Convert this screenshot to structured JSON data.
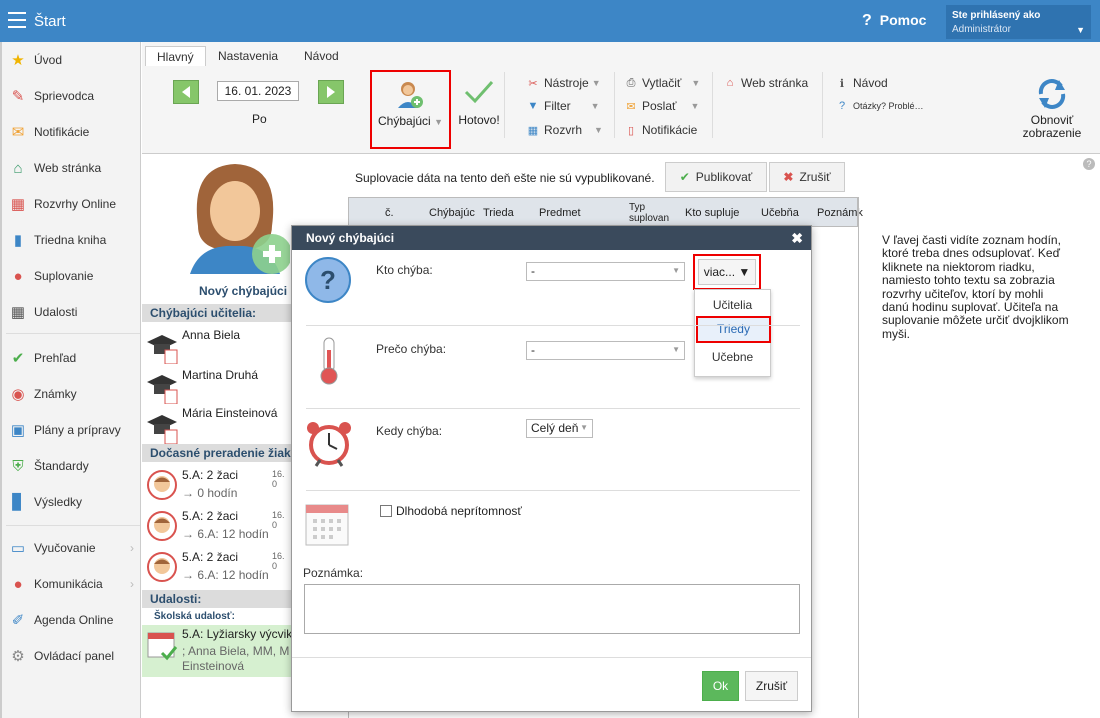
{
  "topbar": {
    "title": "Štart",
    "help": "Pomoc",
    "user_line1": "Ste prihlásený ako",
    "user_line2": "Administrátor"
  },
  "sidebar": {
    "items": [
      {
        "label": "Úvod",
        "icon": "star-icon"
      },
      {
        "label": "Sprievodca",
        "icon": "wand-icon"
      },
      {
        "label": "Notifikácie",
        "icon": "envelope-icon"
      },
      {
        "label": "Web stránka",
        "icon": "house-icon"
      },
      {
        "label": "Rozvrhy Online",
        "icon": "calendar-grid-icon"
      },
      {
        "label": "Triedna kniha",
        "icon": "book-icon"
      },
      {
        "label": "Suplovanie",
        "icon": "person-icon"
      },
      {
        "label": "Udalosti",
        "icon": "calendar-icon"
      },
      {
        "label": "Prehľad",
        "icon": "check-circle-icon"
      },
      {
        "label": "Známky",
        "icon": "grade-icon"
      },
      {
        "label": "Plány a prípravy",
        "icon": "briefcase-icon"
      },
      {
        "label": "Štandardy",
        "icon": "shield-icon"
      },
      {
        "label": "Výsledky",
        "icon": "bar-chart-icon"
      },
      {
        "label": "Vyučovanie",
        "icon": "open-book-icon"
      },
      {
        "label": "Komunikácia",
        "icon": "chat-icon"
      },
      {
        "label": "Agenda Online",
        "icon": "pen-icon"
      },
      {
        "label": "Ovládací panel",
        "icon": "gear-icon"
      }
    ]
  },
  "ribbon": {
    "tabs": [
      "Hlavný",
      "Nastavenia",
      "Návod"
    ],
    "date": "16. 01. 2023",
    "day": "Po",
    "chybajuci": "Chýbajúci",
    "hotovo": "Hotovo!",
    "nastroje": "Nástroje",
    "filter": "Filter",
    "rozvrh": "Rozvrh",
    "vytlacit": "Vytlačiť",
    "poslat": "Poslať",
    "notifikacie": "Notifikácie",
    "web": "Web stránka",
    "navod": "Návod",
    "otazky": "Otázky? Problé…",
    "obnovit1": "Obnoviť",
    "obnovit2": "zobrazenie"
  },
  "left": {
    "new_absent": "Nový chýbajúci",
    "teachers_head": "Chýbajúci učitelia:",
    "teachers": [
      "Anna Biela",
      "Martina Druhá",
      "Mária Einsteinová"
    ],
    "regroup_head": "Dočasné preradenie žiakov",
    "regroups": [
      {
        "title": "5.A: 2 žaci",
        "sub": "→ 0 hodín",
        "date": "16. 0"
      },
      {
        "title": "5.A: 2 žaci",
        "sub": "→ 6.A: 12 hodín",
        "date": "16. 0"
      },
      {
        "title": "5.A: 2 žaci",
        "sub": "→ 6.A: 12 hodín",
        "date": "16. 0"
      }
    ],
    "events_head": "Udalosti:",
    "events_sub": "Školská udalosť:",
    "event_line1": "5.A: Lyžiarsky výcvik",
    "event_line2": "; Anna Biela, MM, M",
    "event_line3": "Einsteinová"
  },
  "content": {
    "message": "Suplovacie dáta na tento deň ešte nie sú vypublikované.",
    "publish": "Publikovať",
    "cancel": "Zrušiť",
    "columns": [
      "č.",
      "Chýbajúc",
      "Trieda",
      "Predmet",
      "Typ suplovan",
      "Kto supluje",
      "Učebňa",
      "Poznámk"
    ]
  },
  "help_text": "V ľavej časti vidíte zoznam hodín, ktoré treba dnes odsuplovať. Keď kliknete na niektorom riadku, namiesto tohto textu sa zobrazia rozvrhy učiteľov, ktorí by mohli danú hodinu suplovať. Učiteľa na suplovanie môžete určiť dvojklikom myši.",
  "modal": {
    "title": "Nový chýbajúci",
    "kto_label": "Kto chýba:",
    "kto_value": "-",
    "viac": "viac... ▼",
    "menu": [
      "Učitelia",
      "Triedy",
      "Učebne"
    ],
    "preco_label": "Prečo chýba:",
    "preco_value": "-",
    "kedy_label": "Kedy chýba:",
    "kedy_value": "Celý deň",
    "dlhodoba": "Dlhodobá neprítomnosť",
    "poznamka": "Poznámka:",
    "ok": "Ok",
    "zrusit": "Zrušiť"
  }
}
